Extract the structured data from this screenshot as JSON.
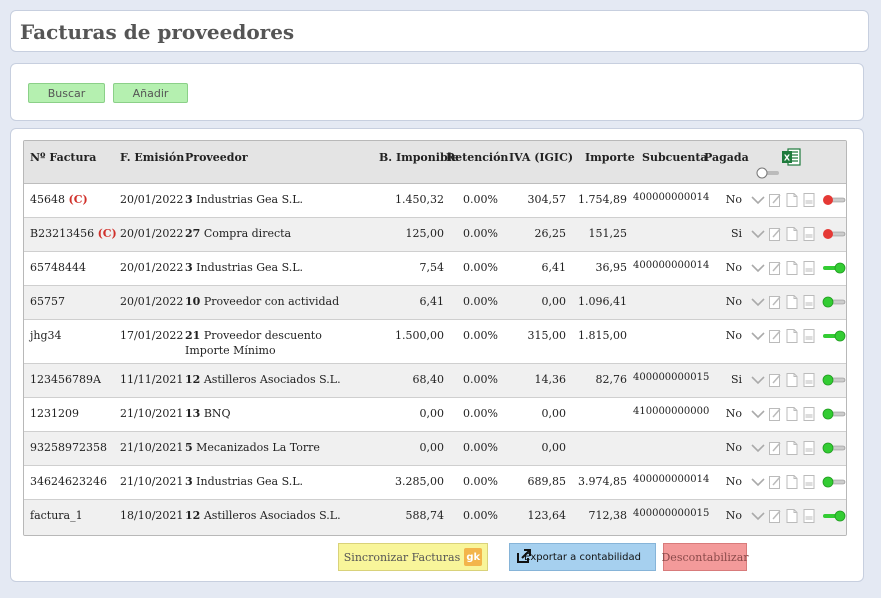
{
  "page": {
    "title": "Facturas de proveedores"
  },
  "search": {
    "buscar_label": "Buscar",
    "anadir_label": "Añadir"
  },
  "table": {
    "headers": {
      "factura": "Nº Factura",
      "emision": "F. Emisión",
      "proveedor": "Proveedor",
      "base": "B. Imponible",
      "retencion": "Retención",
      "iva": "IVA (IGIC)",
      "importe": "Importe",
      "subcuenta": "Subcuenta",
      "pagada": "Pagada"
    },
    "header_icons": {
      "export": "excel-icon",
      "toggle": "toggle-off-icon"
    },
    "rows": [
      {
        "factura": "45648",
        "mark": "(C)",
        "emision": "20/01/2022",
        "prov_num": "3",
        "prov_name": "Industrias Gea S.L.",
        "base": "1.450,32",
        "retencion": "0.00%",
        "iva": "304,57",
        "importe": "1.754,89",
        "subcuenta": "400000000014",
        "pagada": "No",
        "toggle": "red"
      },
      {
        "factura": "B23213456",
        "mark": "(C)",
        "emision": "20/01/2022",
        "prov_num": "27",
        "prov_name": "Compra directa",
        "base": "125,00",
        "retencion": "0.00%",
        "iva": "26,25",
        "importe": "151,25",
        "subcuenta": "",
        "pagada": "Si",
        "toggle": "red"
      },
      {
        "factura": "65748444",
        "mark": "",
        "emision": "20/01/2022",
        "prov_num": "3",
        "prov_name": "Industrias Gea S.L.",
        "base": "7,54",
        "retencion": "0.00%",
        "iva": "6,41",
        "importe": "36,95",
        "subcuenta": "400000000014",
        "pagada": "No",
        "toggle": "on"
      },
      {
        "factura": "65757",
        "mark": "",
        "emision": "20/01/2022",
        "prov_num": "10",
        "prov_name": "Proveedor con actividad",
        "base": "6,41",
        "retencion": "0.00%",
        "iva": "0,00",
        "importe": "1.096,41",
        "subcuenta": "",
        "pagada": "No",
        "toggle": "off"
      },
      {
        "factura": "jhg34",
        "mark": "",
        "emision": "17/01/2022",
        "prov_num": "21",
        "prov_name": "Proveedor descuento Importe Mínimo",
        "base": "1.500,00",
        "retencion": "0.00%",
        "iva": "315,00",
        "importe": "1.815,00",
        "subcuenta": "",
        "pagada": "No",
        "toggle": "on"
      },
      {
        "factura": "123456789A",
        "mark": "",
        "emision": "11/11/2021",
        "prov_num": "12",
        "prov_name": "Astilleros Asociados S.L.",
        "base": "68,40",
        "retencion": "0.00%",
        "iva": "14,36",
        "importe": "82,76",
        "subcuenta": "400000000015",
        "pagada": "Si",
        "toggle": "off"
      },
      {
        "factura": "1231209",
        "mark": "",
        "emision": "21/10/2021",
        "prov_num": "13",
        "prov_name": "BNQ",
        "base": "0,00",
        "retencion": "0.00%",
        "iva": "0,00",
        "importe": "",
        "subcuenta": "410000000000",
        "pagada": "No",
        "toggle": "off"
      },
      {
        "factura": "93258972358",
        "mark": "",
        "emision": "21/10/2021",
        "prov_num": "5",
        "prov_name": "Mecanizados La Torre",
        "base": "0,00",
        "retencion": "0.00%",
        "iva": "0,00",
        "importe": "",
        "subcuenta": "",
        "pagada": "No",
        "toggle": "off"
      },
      {
        "factura": "34624623246",
        "mark": "",
        "emision": "21/10/2021",
        "prov_num": "3",
        "prov_name": "Industrias Gea S.L.",
        "base": "3.285,00",
        "retencion": "0.00%",
        "iva": "689,85",
        "importe": "3.974,85",
        "subcuenta": "400000000014",
        "pagada": "No",
        "toggle": "off"
      },
      {
        "factura": "factura_1",
        "mark": "",
        "emision": "18/10/2021",
        "prov_num": "12",
        "prov_name": "Astilleros Asociados S.L.",
        "base": "588,74",
        "retencion": "0.00%",
        "iva": "123,64",
        "importe": "712,38",
        "subcuenta": "400000000015",
        "pagada": "No",
        "toggle": "on"
      }
    ]
  },
  "footer": {
    "sync_label": "Sincronizar Facturas",
    "sync_logo": "gk",
    "export_label": "Exportar a contabilidad",
    "descont_label": "Descontabilizar"
  },
  "colors": {
    "toggle_red": "#e53935",
    "toggle_green": "#33cc33",
    "button_green": "#b5f0b0",
    "mark_red": "#d0302a"
  }
}
